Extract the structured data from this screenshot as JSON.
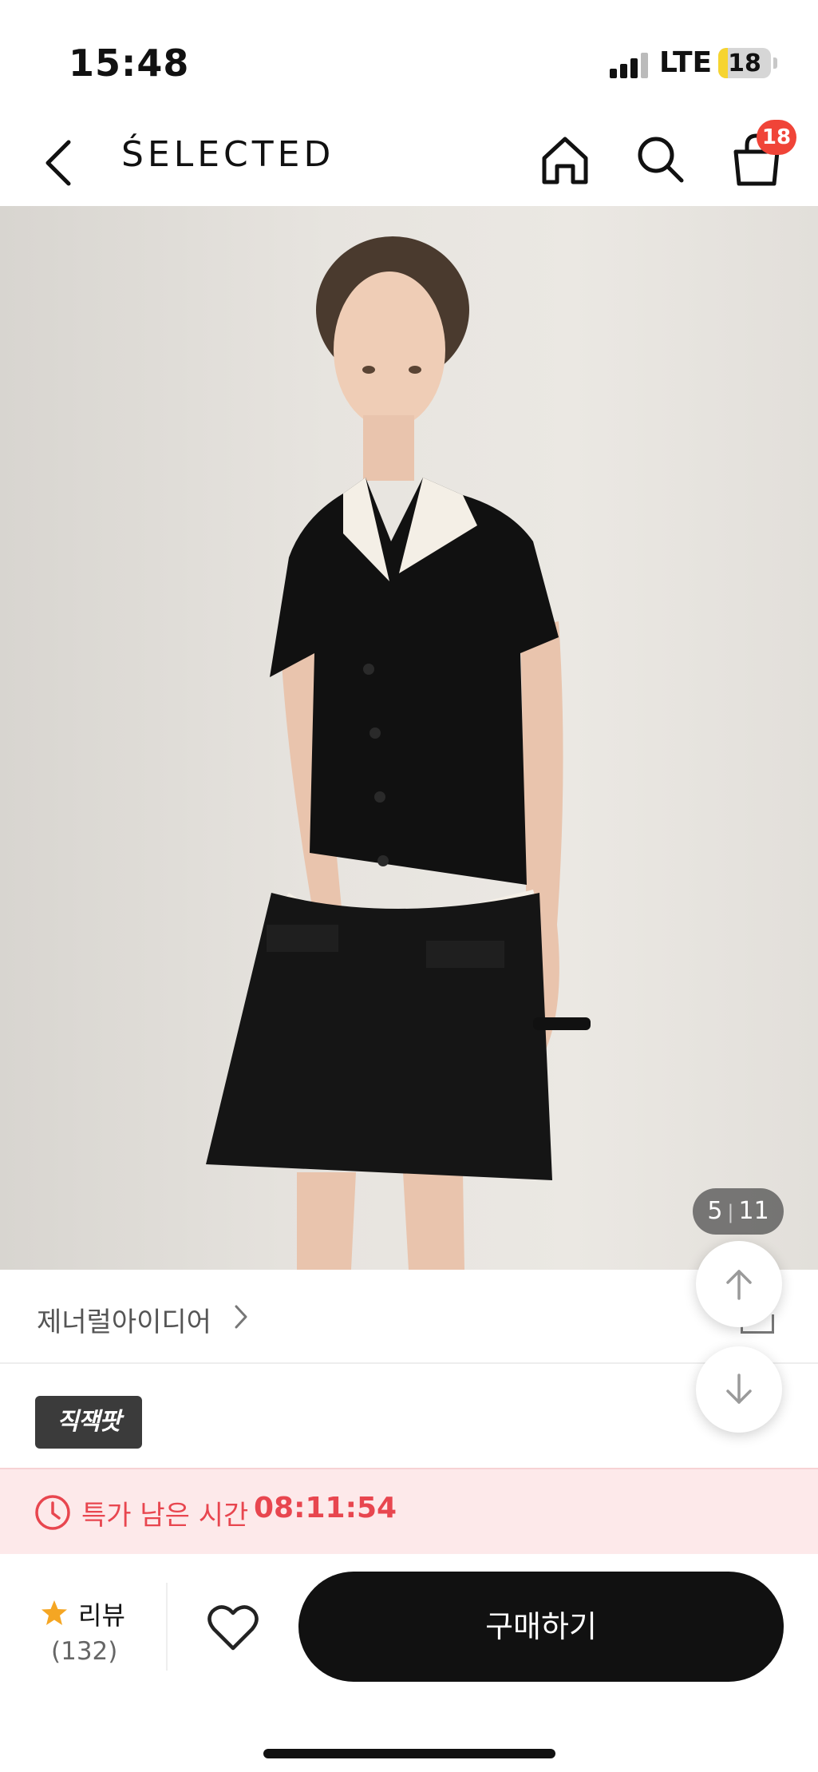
{
  "status_bar": {
    "time": "15:48",
    "network": "LTE",
    "battery_level": "18"
  },
  "header": {
    "brand": "ŚELECTED",
    "cart_count": "18",
    "icons": [
      "back-icon",
      "home-icon",
      "search-icon",
      "shopping-bag-icon"
    ]
  },
  "gallery": {
    "current": "5",
    "total": "11"
  },
  "product": {
    "brand_name": "제너럴아이디어",
    "badge": "직잭팟"
  },
  "timer": {
    "label": "특가 남은 시간",
    "value": "08:11:54",
    "color": "#e8464f"
  },
  "bottom_bar": {
    "review_label": "리뷰",
    "review_count": "(132)",
    "buy_label": "구매하기"
  },
  "colors": {
    "accent_badge": "#f04438",
    "buy_button": "#111111",
    "timer_bg": "#fde9ea",
    "star": "#f5a623"
  }
}
